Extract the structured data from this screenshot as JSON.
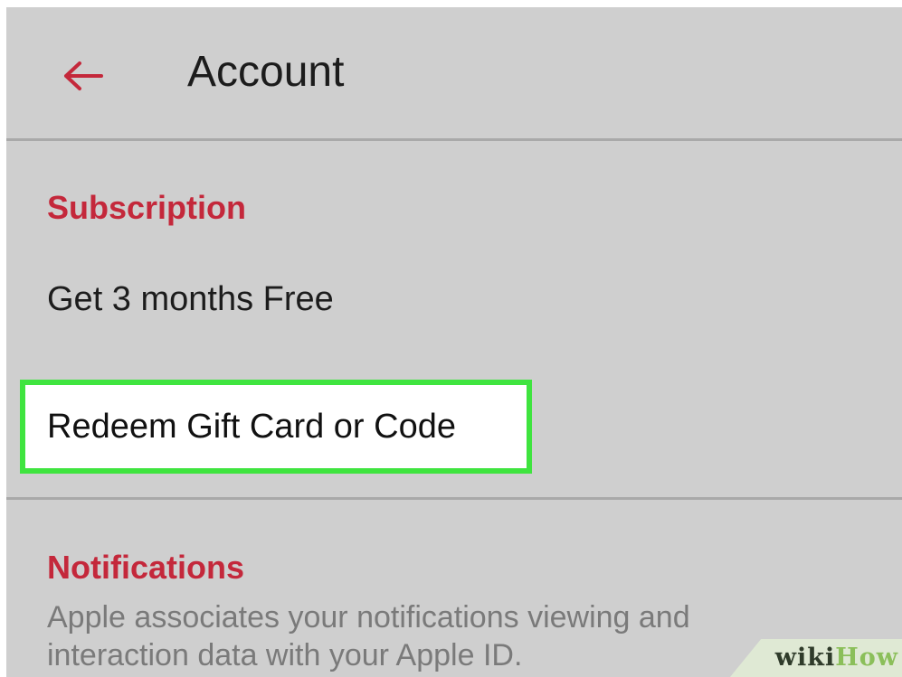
{
  "header": {
    "title": "Account",
    "back_icon": "arrow-left-icon",
    "accent_color": "#c4283b"
  },
  "sections": {
    "subscription": {
      "heading": "Subscription",
      "items": [
        {
          "label": "Get 3 months Free"
        },
        {
          "label": "Redeem Gift Card or Code",
          "highlighted": true
        }
      ]
    },
    "notifications": {
      "heading": "Notifications",
      "description": "Apple associates your notifications viewing and interaction data with your Apple ID."
    }
  },
  "highlight_color": "#3fe43f",
  "watermark": {
    "wiki": "wiki",
    "how": "How"
  }
}
